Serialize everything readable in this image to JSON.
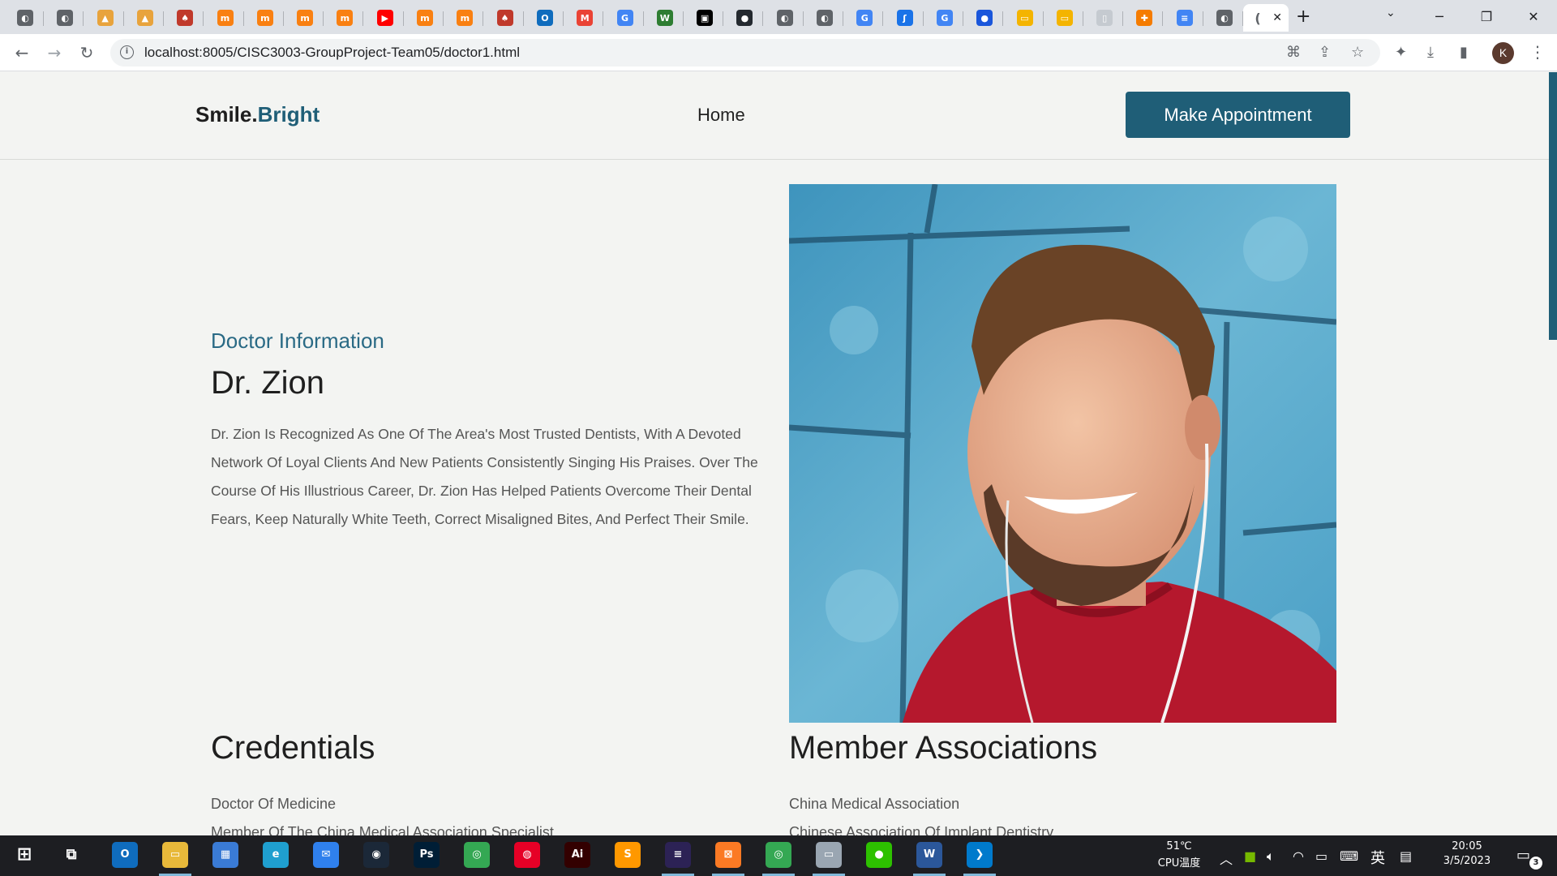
{
  "browser": {
    "tab_favicons": [
      {
        "icon": "globe-icon",
        "color": "#5f6368",
        "glyph": "◐"
      },
      {
        "icon": "globe-icon",
        "color": "#5f6368",
        "glyph": "◐"
      },
      {
        "icon": "phpmyadmin-icon",
        "color": "#e8a33c",
        "glyph": "▲"
      },
      {
        "icon": "phpmyadmin-icon",
        "color": "#e8a33c",
        "glyph": "▲"
      },
      {
        "icon": "red-logo-icon",
        "color": "#c0392b",
        "glyph": "♠"
      },
      {
        "icon": "moodle-icon",
        "color": "#f98012",
        "glyph": "m"
      },
      {
        "icon": "moodle-icon",
        "color": "#f98012",
        "glyph": "m"
      },
      {
        "icon": "moodle-icon",
        "color": "#f98012",
        "glyph": "m"
      },
      {
        "icon": "moodle-icon",
        "color": "#f98012",
        "glyph": "m"
      },
      {
        "icon": "youtube-icon",
        "color": "#ff0000",
        "glyph": "▶"
      },
      {
        "icon": "moodle-icon",
        "color": "#f98012",
        "glyph": "m"
      },
      {
        "icon": "moodle-icon",
        "color": "#f98012",
        "glyph": "m"
      },
      {
        "icon": "red-logo-icon",
        "color": "#c0392b",
        "glyph": "♠"
      },
      {
        "icon": "outlook-icon",
        "color": "#0f6cbd",
        "glyph": "O"
      },
      {
        "icon": "gmail-icon",
        "color": "#ea4335",
        "glyph": "M"
      },
      {
        "icon": "google-icon",
        "color": "#4285f4",
        "glyph": "G"
      },
      {
        "icon": "webassign-icon",
        "color": "#2e7d32",
        "glyph": "W"
      },
      {
        "icon": "notion-icon",
        "color": "#000000",
        "glyph": "▣"
      },
      {
        "icon": "github-icon",
        "color": "#24292f",
        "glyph": "●"
      },
      {
        "icon": "globe-icon",
        "color": "#5f6368",
        "glyph": "◐"
      },
      {
        "icon": "globe-icon",
        "color": "#5f6368",
        "glyph": "◐"
      },
      {
        "icon": "google-icon",
        "color": "#4285f4",
        "glyph": "G"
      },
      {
        "icon": "signature-icon",
        "color": "#1a73e8",
        "glyph": "ʃ"
      },
      {
        "icon": "google-icon",
        "color": "#4285f4",
        "glyph": "G"
      },
      {
        "icon": "edge-blue-icon",
        "color": "#1a56db",
        "glyph": "●"
      },
      {
        "icon": "slides-icon",
        "color": "#f4b400",
        "glyph": "▭"
      },
      {
        "icon": "slides-icon",
        "color": "#f4b400",
        "glyph": "▭"
      },
      {
        "icon": "blank-doc-icon",
        "color": "#c5cad0",
        "glyph": "▯"
      },
      {
        "icon": "puzzle-orange-icon",
        "color": "#f57c00",
        "glyph": "✚"
      },
      {
        "icon": "docs-icon",
        "color": "#4285f4",
        "glyph": "≡"
      },
      {
        "icon": "globe-icon",
        "color": "#5f6368",
        "glyph": "◐"
      }
    ],
    "active_tab_favicon": {
      "icon": "loading-icon",
      "glyph": "("
    },
    "url": "localhost:8005/CISC3003-GroupProject-Team05/doctor1.html",
    "profile_initial": "K"
  },
  "site": {
    "logo": {
      "main": "Smile.",
      "accent": "Bright"
    },
    "nav": {
      "home": "Home"
    },
    "cta_label": "Make Appointment",
    "doctor": {
      "subtitle": "Doctor Information",
      "name": "Dr. Zion",
      "bio": "Dr. Zion Is Recognized As One Of The Area's Most Trusted Dentists, With A Devoted Network Of Loyal Clients And New Patients Consistently Singing His Praises. Over The Course Of His Illustrious Career, Dr. Zion Has Helped Patients Overcome Their Dental Fears, Keep Naturally White Teeth, Correct Misaligned Bites, And Perfect Their Smile."
    },
    "credentials": {
      "title": "Credentials",
      "items": [
        "Doctor Of Medicine",
        "Member Of The China Medical Association Specialist"
      ]
    },
    "associations": {
      "title": "Member Associations",
      "items": [
        "China Medical Association",
        "Chinese Association Of Implant Dentistry"
      ]
    },
    "accent_color": "#1f5e77"
  },
  "taskbar": {
    "apps": [
      {
        "icon": "outlook-icon",
        "color": "#0f6cbd",
        "glyph": "O",
        "running": false
      },
      {
        "icon": "file-explorer-icon",
        "color": "#e8b93a",
        "glyph": "▭",
        "running": true
      },
      {
        "icon": "store-icon",
        "color": "#3a7bd5",
        "glyph": "▦",
        "running": false
      },
      {
        "icon": "edge-icon",
        "color": "#1f9fcf",
        "glyph": "e",
        "running": false
      },
      {
        "icon": "mail-icon",
        "color": "#2f80ed",
        "glyph": "✉",
        "running": false
      },
      {
        "icon": "steam-icon",
        "color": "#1b2838",
        "glyph": "◉",
        "running": false
      },
      {
        "icon": "photoshop-icon",
        "color": "#001e36",
        "glyph": "Ps",
        "running": false
      },
      {
        "icon": "chrome-icon",
        "color": "#34a853",
        "glyph": "◎",
        "running": false
      },
      {
        "icon": "netease-music-icon",
        "color": "#e60026",
        "glyph": "◍",
        "running": false
      },
      {
        "icon": "illustrator-icon",
        "color": "#330000",
        "glyph": "Ai",
        "running": false
      },
      {
        "icon": "sublime-icon",
        "color": "#ff9800",
        "glyph": "S",
        "running": false
      },
      {
        "icon": "eclipse-icon",
        "color": "#2c2255",
        "glyph": "≡",
        "running": true
      },
      {
        "icon": "xampp-icon",
        "color": "#fb7a24",
        "glyph": "⊠",
        "running": true
      },
      {
        "icon": "chrome-profile-icon",
        "color": "#34a853",
        "glyph": "◎",
        "running": true
      },
      {
        "icon": "laptop-icon",
        "color": "#9aa6b2",
        "glyph": "▭",
        "running": true
      },
      {
        "icon": "wechat-icon",
        "color": "#2dc100",
        "glyph": "●",
        "running": false
      },
      {
        "icon": "word-icon",
        "color": "#2b579a",
        "glyph": "W",
        "running": true
      },
      {
        "icon": "vscode-icon",
        "color": "#007acc",
        "glyph": "❯",
        "running": true
      }
    ],
    "temperature": "51℃",
    "temperature_label": "CPU温度",
    "ime": "英",
    "time": "20:05",
    "date": "3/5/2023",
    "notification_count": "3"
  }
}
